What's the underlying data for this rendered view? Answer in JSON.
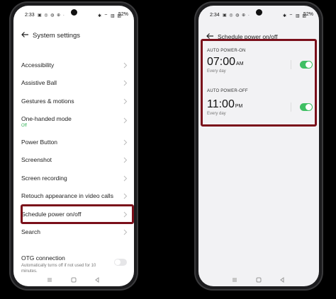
{
  "left_phone": {
    "status": {
      "time": "2:33",
      "icons": "▣ ◎ ◍ ⊕ ·",
      "right_icons": "✱ ⌔ ▥ ▥",
      "battery": "52%"
    },
    "header": {
      "title": "System settings"
    },
    "items": [
      {
        "label": "Accessibility"
      },
      {
        "label": "Assistive Ball"
      },
      {
        "label": "Gestures & motions"
      },
      {
        "label": "One-handed mode",
        "sub": "Off"
      },
      {
        "label": "Power Button"
      },
      {
        "label": "Screenshot"
      },
      {
        "label": "Screen recording"
      },
      {
        "label": "Retouch appearance in video calls"
      },
      {
        "label": "Schedule power on/off"
      },
      {
        "label": "Search"
      }
    ],
    "otg": {
      "label": "OTG connection",
      "sub": "Automatically turns off if not used for 10 minutes."
    }
  },
  "right_phone": {
    "status": {
      "time": "2:34",
      "icons": "▣ ◎ ◍ ⊕ ·",
      "right_icons": "✱ ⌔ ▥ ▥",
      "battery": "52%"
    },
    "header": {
      "title": "Schedule power on/off"
    },
    "power_on": {
      "label": "AUTO POWER-ON",
      "time": "07:00",
      "ampm": "AM",
      "repeat": "Every day",
      "enabled": true
    },
    "power_off": {
      "label": "AUTO POWER-OFF",
      "time": "11:00",
      "ampm": "PM",
      "repeat": "Every day",
      "enabled": true
    }
  },
  "colors": {
    "highlight": "#7a0f1a",
    "toggle_on": "#3fbf63",
    "sub_green": "#35b35a"
  }
}
